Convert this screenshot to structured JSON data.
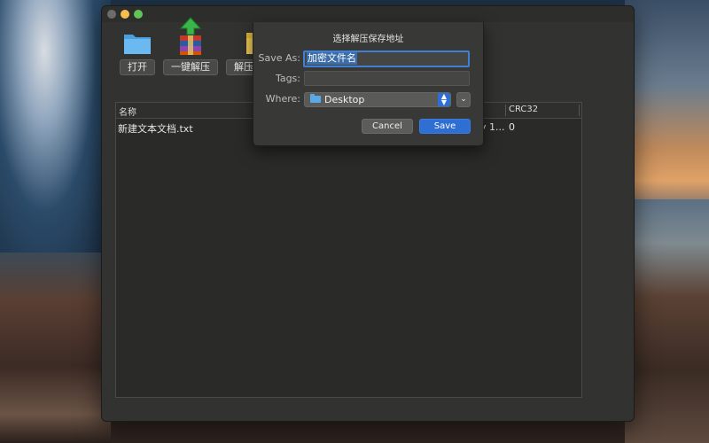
{
  "toolbar": {
    "open_label": "打开",
    "extract_label": "一键解压",
    "extract_to_label": "解压到"
  },
  "table": {
    "headers": [
      "名称",
      "CRC32"
    ],
    "rows": [
      {
        "name": "新建文本文档.txt",
        "modified": "y 1...",
        "crc32": "0"
      }
    ]
  },
  "dialog": {
    "title": "选择解压保存地址",
    "save_as_label": "Save As:",
    "save_as_value": "加密文件名",
    "tags_label": "Tags:",
    "tags_value": "",
    "where_label": "Where:",
    "where_value": "Desktop",
    "cancel_label": "Cancel",
    "save_label": "Save"
  },
  "colors": {
    "accent": "#2f6ed3",
    "window_bg": "#323230",
    "traffic_min": "#f6be4f",
    "traffic_max": "#61c454"
  },
  "icons": [
    "folder-icon",
    "books-extract-icon",
    "folder-extract-icon",
    "stepper-icon",
    "chevron-down-icon"
  ]
}
